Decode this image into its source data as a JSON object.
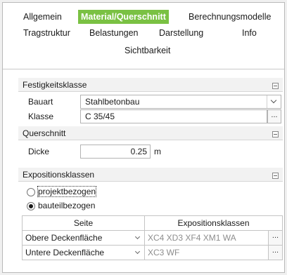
{
  "tabs": [
    {
      "label": "Allgemein",
      "active": false
    },
    {
      "label": "Material/Querschnitt",
      "active": true
    },
    {
      "label": "Berechnungsmodelle",
      "active": false
    },
    {
      "label": "Tragstruktur",
      "active": false
    },
    {
      "label": "Belastungen",
      "active": false
    },
    {
      "label": "Darstellung",
      "active": false
    },
    {
      "label": "Info",
      "active": false
    },
    {
      "label": "Sichtbarkeit",
      "active": false
    }
  ],
  "accent_color": "#7ac143",
  "festigkeitsklasse": {
    "title": "Festigkeitsklasse",
    "bauart_label": "Bauart",
    "bauart_value": "Stahlbetonbau",
    "klasse_label": "Klasse",
    "klasse_value": "C 35/45",
    "ellipsis": "..."
  },
  "querschnitt": {
    "title": "Querschnitt",
    "dicke_label": "Dicke",
    "dicke_value": "0.25",
    "dicke_unit": "m"
  },
  "expositionsklassen": {
    "title": "Expositionsklassen",
    "radio_projekt": "projektbezogen",
    "radio_bauteil": "bauteilbezogen",
    "selected": "bauteilbezogen",
    "table": {
      "headers": [
        "Seite",
        "Expositionsklassen"
      ],
      "rows": [
        {
          "seite": "Obere Deckenfläche",
          "klassen": "XC4 XD3 XF4 XM1 WA"
        },
        {
          "seite": "Untere Deckenfläche",
          "klassen": "XC3 WF"
        }
      ],
      "ellipsis": "..."
    }
  }
}
